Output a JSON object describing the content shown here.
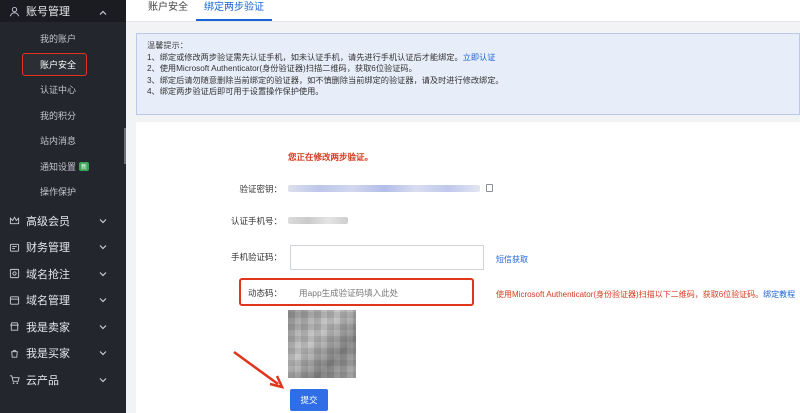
{
  "sidebar": {
    "top_group": {
      "label": "账号管理",
      "icon": "user-icon"
    },
    "sub_items": [
      {
        "label": "我的账户"
      },
      {
        "label": "账户安全"
      },
      {
        "label": "认证中心"
      },
      {
        "label": "我的积分"
      },
      {
        "label": "站内消息"
      },
      {
        "label": "通知设置",
        "tag": "新"
      },
      {
        "label": "操作保护"
      }
    ],
    "groups": [
      {
        "label": "高级会员",
        "icon": "crown-icon"
      },
      {
        "label": "财务管理",
        "icon": "wallet-icon"
      },
      {
        "label": "域名抢注",
        "icon": "domain-snipe-icon"
      },
      {
        "label": "域名管理",
        "icon": "domain-icon"
      },
      {
        "label": "我是卖家",
        "icon": "seller-icon"
      },
      {
        "label": "我是买家",
        "icon": "buyer-icon"
      },
      {
        "label": "云产品",
        "icon": "cart-icon"
      }
    ]
  },
  "tabs": [
    {
      "label": "账户安全"
    },
    {
      "label": "绑定两步验证"
    }
  ],
  "notice": {
    "title": "温馨提示：",
    "lines": [
      "1、绑定或修改两步验证需先认证手机，如未认证手机，请先进行手机认证后才能绑定。",
      "2、使用Microsoft Authenticator(身份验证器)扫描二维码，获取6位验证码。",
      "3、绑定后请勿随意删除当前绑定的验证器，如不慎删除当前绑定的验证器，请及时进行修改绑定。",
      "4、绑定两步验证后即可用于设置操作保护使用。"
    ],
    "link": "立即认证"
  },
  "form": {
    "editing_text": "您正在修改两步验证。",
    "secret_label": "验证密钥：",
    "phone_label": "认证手机号：",
    "sms_label": "手机验证码：",
    "sms_value": "",
    "sms_link": "短信获取",
    "dynamic_label": "动态码：",
    "dynamic_placeholder": "用app生成验证码填入此处",
    "hint": "使用Microsoft Authenticator(身份验证器)扫描以下二维码，获取6位验证码。",
    "hint_link": "绑定教程",
    "submit": "提交"
  },
  "colors": {
    "sidebar_bg": "#24262d",
    "accent": "#1b64d6",
    "highlight_red": "#e0341d",
    "submit_bg": "#2f6ee6"
  }
}
